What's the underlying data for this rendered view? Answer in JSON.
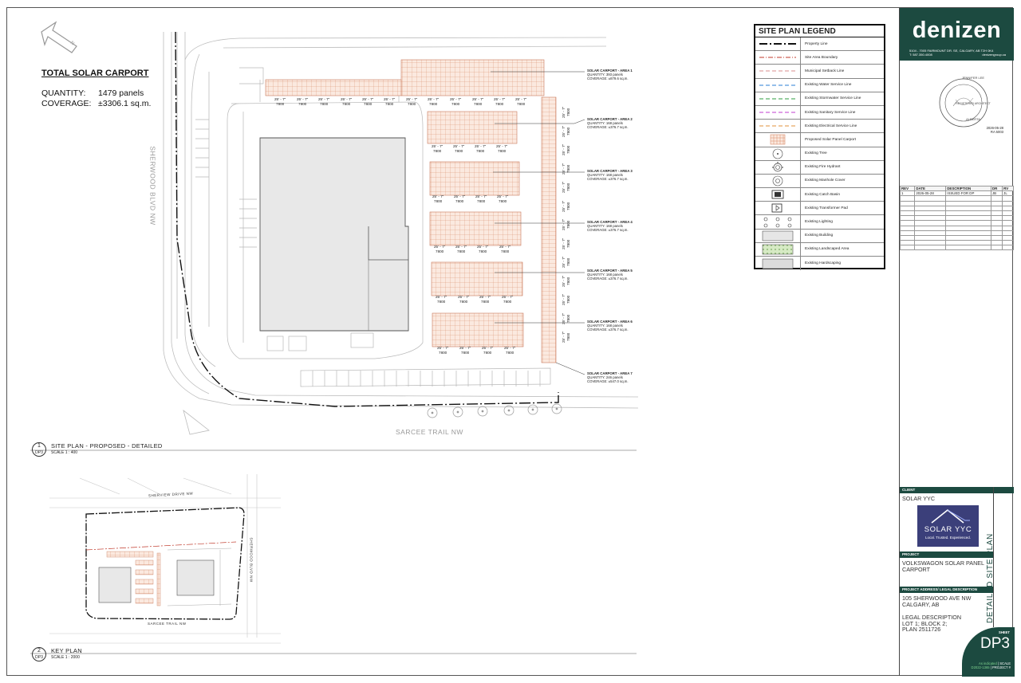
{
  "totals": {
    "title": "TOTAL SOLAR CARPORT",
    "quantity_label": "QUANTITY:",
    "quantity_value": "1479 panels",
    "coverage_label": "COVERAGE:",
    "coverage_value": "±3306.1 sq.m."
  },
  "legend": {
    "title": "SITE PLAN LEGEND",
    "items": [
      {
        "label": "Property Line",
        "icon": "property-line-symbol",
        "color": "#111111"
      },
      {
        "label": "Site Area Boundary",
        "icon": "site-boundary-symbol",
        "color": "#c0392b"
      },
      {
        "label": "Municipal Setback Line",
        "icon": "setback-line-symbol",
        "color": "#d98c8c"
      },
      {
        "label": "Existing Water Service Line",
        "icon": "water-line-symbol",
        "color": "#2a7fd4"
      },
      {
        "label": "Existing Stormwater Service Line",
        "icon": "stormwater-line-symbol",
        "color": "#2e9e3f"
      },
      {
        "label": "Existing Sanitary Service Line",
        "icon": "sanitary-line-symbol",
        "color": "#c03ccf"
      },
      {
        "label": "Existing Electrical Service Line",
        "icon": "electrical-line-symbol",
        "color": "#e0913a"
      },
      {
        "label": "Proposed Solar Panel Carport",
        "icon": "solar-panel-symbol",
        "color": "#d98c6a"
      },
      {
        "label": "Existing Tree",
        "icon": "tree-symbol"
      },
      {
        "label": "Existing Fire Hydrant",
        "icon": "fire-hydrant-symbol"
      },
      {
        "label": "Existing Manhole Cover",
        "icon": "manhole-symbol"
      },
      {
        "label": "Existing Catch Basin",
        "icon": "catch-basin-symbol"
      },
      {
        "label": "Existing Transformer Pad",
        "icon": "transformer-symbol"
      },
      {
        "label": "Existing Lighting",
        "icon": "lighting-symbol"
      },
      {
        "label": "Existing Building",
        "icon": "building-symbol",
        "color": "#e6e6e6"
      },
      {
        "label": "Existing Landscaped Area",
        "icon": "landscape-symbol",
        "color": "#cfe6b8"
      },
      {
        "label": "Existing Hardscaping",
        "icon": "hardscape-symbol",
        "color": "#dcdcdc"
      }
    ]
  },
  "areas": [
    {
      "title": "SOLAR CARPORT - AREA 1",
      "quantity": "QUANTITY: 393 panels",
      "coverage": "COVERAGE: ±879.6 sq.m."
    },
    {
      "title": "SOLAR CARPORT - AREA 2",
      "quantity": "QUANTITY: 168 panels",
      "coverage": "COVERAGE: ±376.7 sq.m."
    },
    {
      "title": "SOLAR CARPORT - AREA 3",
      "quantity": "QUANTITY: 168 panels",
      "coverage": "COVERAGE: ±376.7 sq.m."
    },
    {
      "title": "SOLAR CARPORT - AREA 4",
      "quantity": "QUANTITY: 168 panels",
      "coverage": "COVERAGE: ±376.7 sq.m."
    },
    {
      "title": "SOLAR CARPORT - AREA 5",
      "quantity": "QUANTITY: 168 panels",
      "coverage": "COVERAGE: ±376.7 sq.m."
    },
    {
      "title": "SOLAR CARPORT - AREA 6",
      "quantity": "QUANTITY: 168 panels",
      "coverage": "COVERAGE: ±376.7 sq.m."
    },
    {
      "title": "SOLAR CARPORT - AREA 7",
      "quantity": "QUANTITY: 246 panels",
      "coverage": "COVERAGE: ±547.0 sq.m."
    }
  ],
  "dims": {
    "feet": "25' - 7\"",
    "mm": "7800"
  },
  "roads": {
    "sherwood": "SHERWOOD BLVD NW",
    "sarcee": "SARCEE TRAIL NW",
    "sherview_key": "SHERVIEW DRIVE NW",
    "sherwood_key": "SHERWOOD BLVD NW",
    "sarcee_key": "SARCEE TRAIL NW"
  },
  "site_plan": {
    "number": "1",
    "sheet": "DP3",
    "title": "SITE PLAN - PROPOSED - DETAILED",
    "scale": "SCALE 1 : 400"
  },
  "key_plan": {
    "number": "2",
    "sheet": "DP3",
    "title": "KEY PLAN",
    "scale": "SCALE 1 : 2000"
  },
  "north": "N",
  "titleblock": {
    "logo": "denizen",
    "address": "5104 - 7005 FAIRMOUNT DR. SE, CALGARY, AB T2H 0K4",
    "phone": "T: 587.350.4008",
    "website": "denizengroup.ca",
    "stamp_top": "JENNIFER LEE",
    "stamp_center": "REGISTERED ARCHITECT",
    "stamp_bottom": "ALBERTA",
    "stamp_date": "2026-05-28",
    "stamp_id": "RA 5003",
    "rev_headers": [
      "REV",
      "DATE",
      "DESCRIPTION",
      "DR",
      "RV"
    ],
    "rev_rows": [
      [
        "1",
        "2026-05-28",
        "ISSUED FOR DP",
        "JB",
        "JL"
      ]
    ],
    "client_header": "CLIENT",
    "client_name": "SOLAR YYC",
    "client_logo_name": "SOLAR YYC",
    "client_logo_tag": "Local. Trusted. Experienced.",
    "project_header": "PROJECT",
    "project_name": "VOLKSWAGON SOLAR PANEL CARPORT",
    "address_header": "PROJECT ADDRESS/ LEGAL DESCRIPTION",
    "address_line1": "105 SHERWOOD AVE NW",
    "address_line2": "CALGARY, AB",
    "legal_label": "LEGAL DESCRIPTION",
    "legal_line1": "LOT 1; BLOCK 2;",
    "legal_line2": "PLAN 2511726",
    "sheet_title": "DETAILED SITE PLAN",
    "sheet_label": "SHEET",
    "sheet_number": "DP3",
    "scale_note": "As indicated",
    "scale_label": "SCALE",
    "project_no": "D2022-1365",
    "project_label": "PROJECT #"
  }
}
